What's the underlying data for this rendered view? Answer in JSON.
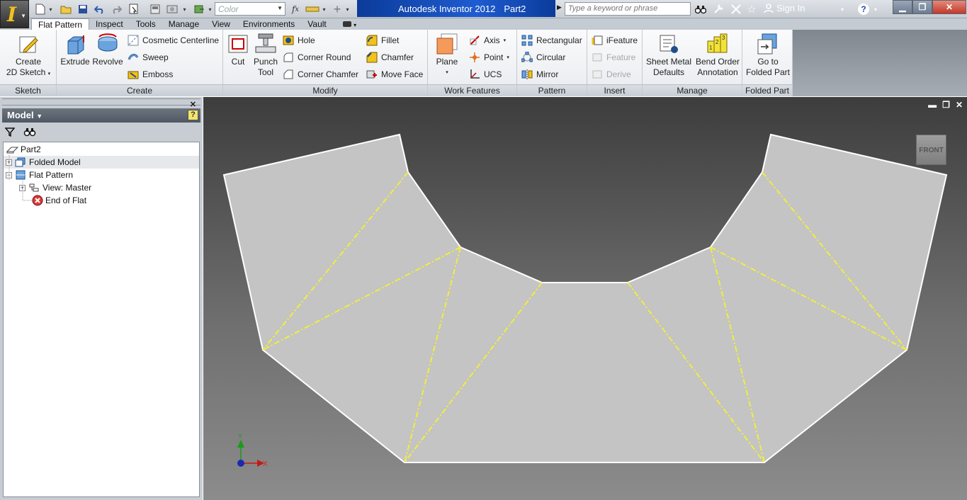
{
  "app": {
    "title": "Autodesk Inventor 2012",
    "document": "Part2",
    "color_placeholder": "Color",
    "search_placeholder": "Type a keyword or phrase",
    "sign_in": "Sign In",
    "help": "?"
  },
  "tabs": [
    "Flat Pattern",
    "Inspect",
    "Tools",
    "Manage",
    "View",
    "Environments",
    "Vault"
  ],
  "ribbon": {
    "sketch": {
      "title": "Sketch",
      "create_2d_sketch": [
        "Create",
        "2D Sketch"
      ]
    },
    "create": {
      "title": "Create",
      "extrude": "Extrude",
      "revolve": "Revolve",
      "cosmetic_centerline": "Cosmetic Centerline",
      "sweep": "Sweep",
      "emboss": "Emboss"
    },
    "modify": {
      "title": "Modify",
      "cut": "Cut",
      "punch_tool": [
        "Punch",
        "Tool"
      ],
      "hole": "Hole",
      "corner_round": "Corner Round",
      "corner_chamfer": "Corner Chamfer",
      "fillet": "Fillet",
      "chamfer": "Chamfer",
      "move_face": "Move Face"
    },
    "work_features": {
      "title": "Work Features",
      "plane": "Plane",
      "axis": "Axis",
      "point": "Point",
      "ucs": "UCS"
    },
    "pattern": {
      "title": "Pattern",
      "rectangular": "Rectangular",
      "circular": "Circular",
      "mirror": "Mirror"
    },
    "insert": {
      "title": "Insert",
      "ifeature": "iFeature",
      "feature": "Feature",
      "derive": "Derive"
    },
    "manage": {
      "title": "Manage",
      "sheet_metal_defaults": [
        "Sheet Metal",
        "Defaults"
      ],
      "bend_order_annotation": [
        "Bend Order",
        "Annotation"
      ]
    },
    "folded_part": {
      "title": "Folded Part",
      "go_to_folded_part": [
        "Go to",
        "Folded Part"
      ]
    }
  },
  "browser": {
    "title": "Model",
    "tree": [
      {
        "label": "Part2"
      },
      {
        "label": "Folded Model"
      },
      {
        "label": "Flat Pattern"
      },
      {
        "label": "View: Master"
      },
      {
        "label": "End of Flat"
      }
    ]
  },
  "viewport": {
    "viewcube_face": "FRONT",
    "axis_x": "X",
    "axis_y": "Y",
    "sheet_color": "#c4c4c4",
    "bend_line_color": "#f2ee3a"
  },
  "colors": {
    "title_accent": "#1f5cd0",
    "app_button": "#f2c21b"
  }
}
